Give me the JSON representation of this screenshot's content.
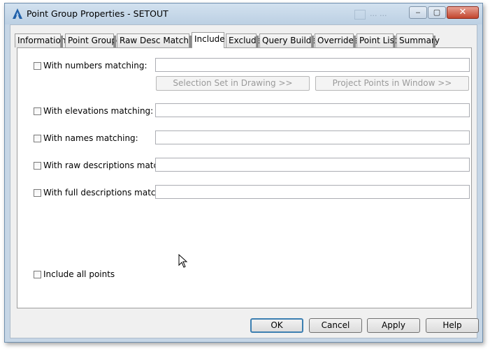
{
  "window": {
    "title": "Point Group Properties - SETOUT",
    "background_ghost_text": "... ...",
    "controls": {
      "minimize": "‒",
      "maximize": "▢",
      "close": "✕"
    }
  },
  "tabs": [
    {
      "label": "Information"
    },
    {
      "label": "Point Groups"
    },
    {
      "label": "Raw Desc Matching"
    },
    {
      "label": "Include"
    },
    {
      "label": "Exclude"
    },
    {
      "label": "Query Builder"
    },
    {
      "label": "Overrides"
    },
    {
      "label": "Point List"
    },
    {
      "label": "Summary"
    }
  ],
  "active_tab": "Include",
  "include": {
    "numbers": {
      "label": "With numbers matching:",
      "checked": false,
      "value": ""
    },
    "elevations": {
      "label": "With elevations matching:",
      "checked": false,
      "value": ""
    },
    "names": {
      "label": "With names matching:",
      "checked": false,
      "value": ""
    },
    "raw_descriptions": {
      "label": "With raw descriptions matching:",
      "checked": false,
      "value": ""
    },
    "full_descriptions": {
      "label": "With full descriptions matching:",
      "checked": false,
      "value": ""
    },
    "selection_set_button": "Selection Set in Drawing >>",
    "project_points_button": "Project Points in Window >>",
    "include_all": {
      "label": "Include all points",
      "checked": false
    }
  },
  "buttons": {
    "ok": "OK",
    "cancel": "Cancel",
    "apply": "Apply",
    "help": "Help"
  },
  "colors": {
    "titlebar": "#c6d6e6",
    "default_button_border": "#3c7fb1",
    "close_button": "#c2452d"
  }
}
